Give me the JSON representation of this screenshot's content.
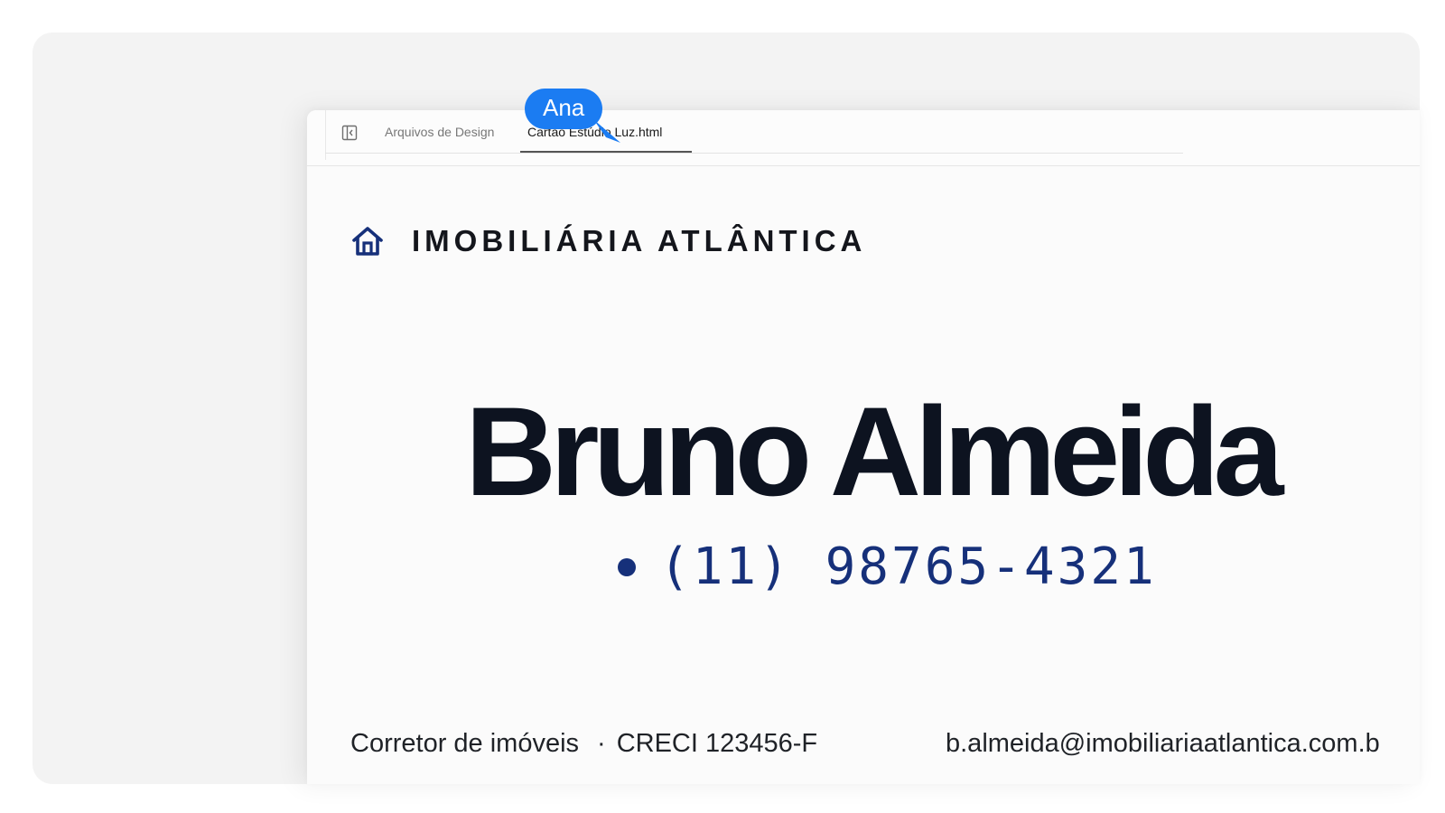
{
  "tabs": [
    {
      "label": "Arquivos de Design"
    },
    {
      "label": "Cartão Estúdio Luz.html"
    }
  ],
  "card": {
    "brand": "IMOBILIÁRIA ATLÂNTICA",
    "name": "Bruno Almeida",
    "phone": "(11) 98765-4321",
    "role": "Corretor de imóveis",
    "separator": "·",
    "creci": "CRECI 123456-F",
    "email": "b.almeida@imobiliariaatlantica.com.b"
  },
  "collaborator": {
    "name": "Ana",
    "color": "#1b7cf2"
  },
  "colors": {
    "brand_blue": "#16307a",
    "name_dark": "#0d1320"
  },
  "icons": {
    "sidebar_toggle": "sidebar-toggle-icon",
    "brand": "home-icon",
    "cursor": "pointer-arrow-icon"
  }
}
